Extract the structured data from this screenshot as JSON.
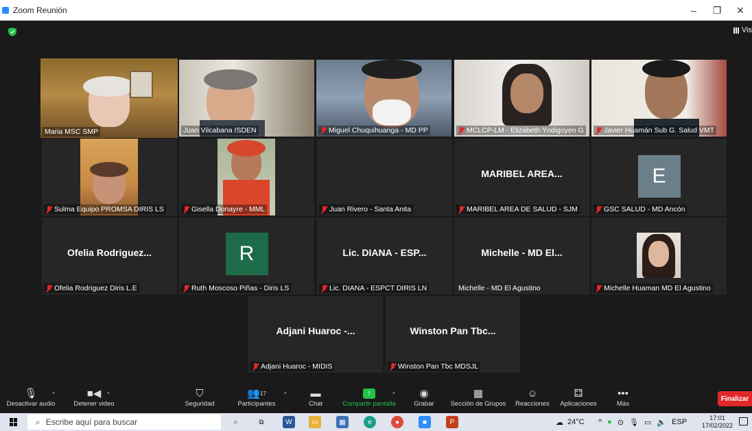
{
  "window": {
    "title": "Zoom Reunión",
    "minimize": "–",
    "restore": "❐",
    "close": "✕"
  },
  "view_label": "Vis",
  "participants": [
    {
      "name": "Maria MSC SMP",
      "muted": false,
      "active": true
    },
    {
      "name": "Juan Vilcabana ISDEN",
      "muted": false
    },
    {
      "name": "Miguel Chuquihuanga - MD PP",
      "muted": true
    },
    {
      "name": "MCLCP-LM - Elizabeth Yndigoyen G",
      "muted": true
    },
    {
      "name": "Javier Huamán Sub G. Salud VMT",
      "muted": true
    },
    {
      "name": "Sulma Equipo PROMSA DIRIS LS",
      "muted": true
    },
    {
      "name": "Gisella Donayre - MML",
      "muted": true
    },
    {
      "name": "Juan Rivero - Santa Anita",
      "muted": true
    },
    {
      "name": "MARIBEL AREA DE SALUD - SJM",
      "muted": true,
      "display": "MARIBEL AREA..."
    },
    {
      "name": "GSC SALUD - MD Ancón",
      "muted": true,
      "avatar_letter": "E",
      "avatar_color": "#6b7f8a"
    },
    {
      "name": "Ofelia Rodriguez Diris L.E",
      "muted": true,
      "display": "Ofelia Rodriguez..."
    },
    {
      "name": "Ruth Moscoso Piñas - Diris LS",
      "muted": true,
      "avatar_letter": "R",
      "avatar_color": "#1e6b4a"
    },
    {
      "name": "Lic. DIANA - ESPCT DIRIS LN",
      "muted": true,
      "display": "Lic. DIANA - ESP..."
    },
    {
      "name": "Michelle - MD El Agustino",
      "muted": false,
      "display": "Michelle - MD El..."
    },
    {
      "name": "Michelle Huaman MD El Agustino",
      "muted": true
    },
    {
      "name": "Adjani Huaroc - MIDIS",
      "muted": true,
      "display": "Adjani Huaroc -..."
    },
    {
      "name": "Winston Pan Tbc MDSJL",
      "muted": true,
      "display": "Winston Pan Tbc..."
    }
  ],
  "toolbar": {
    "mute": "Desactivar audio",
    "video": "Detener video",
    "security": "Seguridad",
    "participants": "Participantes",
    "participants_count": "17",
    "chat": "Chat",
    "share": "Compartir pantalla",
    "record": "Grabar",
    "breakout": "Sección de Grupos",
    "reactions": "Reacciones",
    "apps": "Aplicaciones",
    "more": "Más",
    "end": "Finalizar"
  },
  "taskbar": {
    "search_placeholder": "Escribe aquí para buscar",
    "temperature": "24°C",
    "language": "ESP",
    "time": "17:01",
    "date": "17/02/2022"
  },
  "colors": {
    "active_speaker": "#d2e44a",
    "share_green": "#24c24a",
    "end_red": "#e02828",
    "muted_red": "#e02828"
  }
}
